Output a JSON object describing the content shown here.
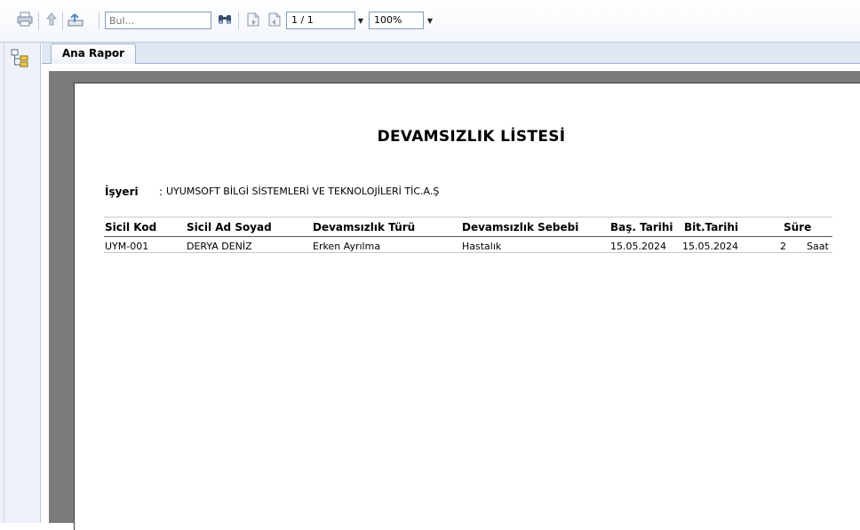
{
  "toolbar": {
    "search_placeholder": "Bul...",
    "page_indicator": "1 / 1",
    "zoom": "100%",
    "icons": [
      "printer-icon",
      "upload-icon",
      "export-icon",
      "binoculars-icon",
      "page-icon",
      "page-forward-icon"
    ]
  },
  "tabs": [
    {
      "label": "Ana Rapor",
      "active": true
    }
  ],
  "report": {
    "title": "DEVAMSIZLIK LİSTESİ",
    "workplace_label": "İşyeri",
    "workplace_colon": ":",
    "workplace_value": "UYUMSOFT BİLGİ SİSTEMLERİ VE TEKNOLOJİLERİ TİC.A.Ş",
    "columns": [
      "Sicil Kod",
      "Sicil Ad Soyad",
      "Devamsızlık Türü",
      "Devamsızlık Sebebi",
      "Baş. Tarihi",
      "Bit.Tarihi",
      "Süre"
    ],
    "rows": [
      {
        "sicil_kod": "UYM-001",
        "ad_soyad": "DERYA DENİZ",
        "tur": "Erken Ayrılma",
        "sebep": "Hastalık",
        "bas_tarihi": "15.05.2024",
        "bit_tarihi": "15.05.2024",
        "sure": "2",
        "birim": "Saat"
      }
    ]
  },
  "colors": {
    "toolbar_border": "#b9c7d9",
    "viewer_background": "#7b7b7b",
    "page_background": "#ffffff"
  }
}
